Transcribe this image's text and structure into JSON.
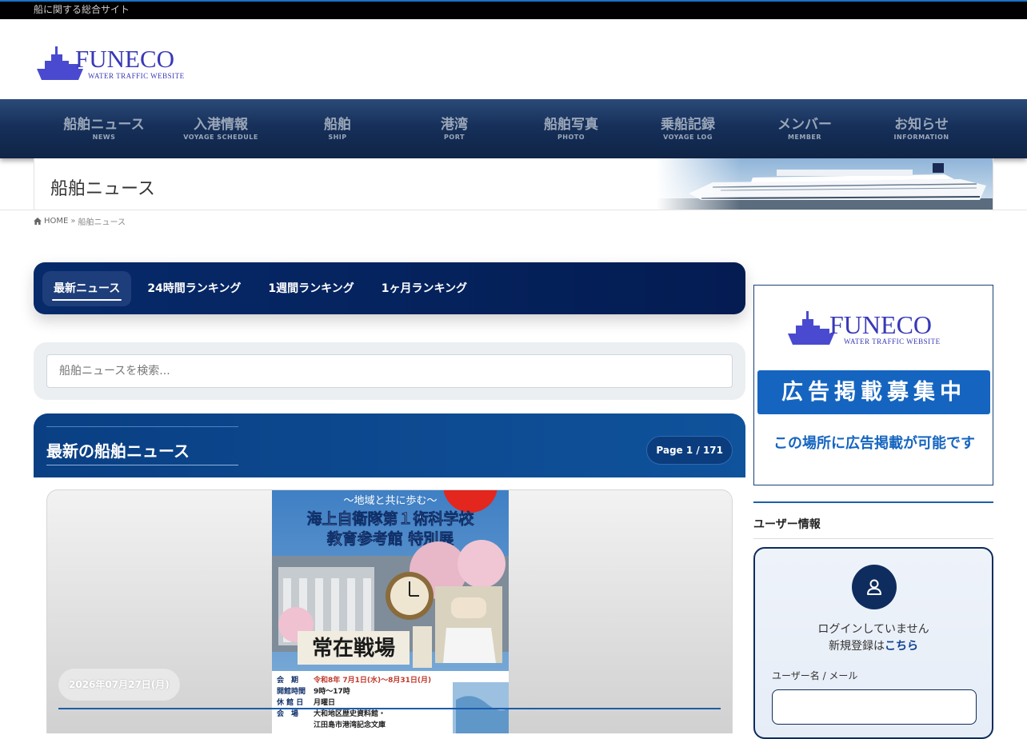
{
  "topbar": {
    "tagline": "船に関する総合サイト"
  },
  "logo": {
    "name": "FUNECO",
    "subtitle": "WATER TRAFFIC WEBSITE"
  },
  "nav": [
    {
      "label": "船舶ニュース",
      "sub": "NEWS"
    },
    {
      "label": "入港情報",
      "sub": "VOYAGE SCHEDULE"
    },
    {
      "label": "船舶",
      "sub": "SHIP"
    },
    {
      "label": "港湾",
      "sub": "PORT"
    },
    {
      "label": "船舶写真",
      "sub": "PHOTO"
    },
    {
      "label": "乗船記録",
      "sub": "VOYAGE LOG"
    },
    {
      "label": "メンバー",
      "sub": "MEMBER"
    },
    {
      "label": "お知らせ",
      "sub": "INFORMATION"
    }
  ],
  "page": {
    "title": "船舶ニュース"
  },
  "breadcrumb": {
    "home": "HOME",
    "sep": "»",
    "current": "船舶ニュース"
  },
  "tabs": [
    {
      "label": "最新ニュース",
      "active": true
    },
    {
      "label": "24時間ランキング",
      "active": false
    },
    {
      "label": "1週間ランキング",
      "active": false
    },
    {
      "label": "1ヶ月ランキング",
      "active": false
    }
  ],
  "search": {
    "placeholder": "船舶ニュースを検索..."
  },
  "news": {
    "heading": "最新の船舶ニュース",
    "page_badge": "Page 1 / 171",
    "card": {
      "date": "2026年07月27日(月)"
    }
  },
  "poster": {
    "motto": "〜地域と共に歩む〜",
    "title_line1": "海上自衛隊第１術科学校",
    "title_line2": "教育参考館 特別展",
    "calligraphy": "常在戦場",
    "info": [
      {
        "label": "会　期",
        "value": "令和8年 7月1日(水)〜8月31日(月)"
      },
      {
        "label": "開館時間",
        "value": "9時〜17時"
      },
      {
        "label": "休 館 日",
        "value": "月曜日"
      },
      {
        "label": "会　場",
        "value": "大和地区歴史資料館・"
      },
      {
        "label": "",
        "value": "江田島市港湾記念文庫"
      }
    ]
  },
  "ad": {
    "logo_name": "FUNECO",
    "logo_subtitle": "WATER TRAFFIC WEBSITE",
    "banner": "広告掲載募集中",
    "text": "この場所に広告掲載が可能です"
  },
  "user": {
    "heading": "ユーザー情報",
    "status": "ログインしていません",
    "register_prefix": "新規登録は",
    "register_link": "こちら",
    "field_label": "ユーザー名 / メール"
  },
  "colors": {
    "nav_bg": "#16305a",
    "tab_bg": "#041c52",
    "news_header": "#0d4b93",
    "ad_blue": "#1565c0",
    "logo_purple": "#3f3fbf"
  }
}
